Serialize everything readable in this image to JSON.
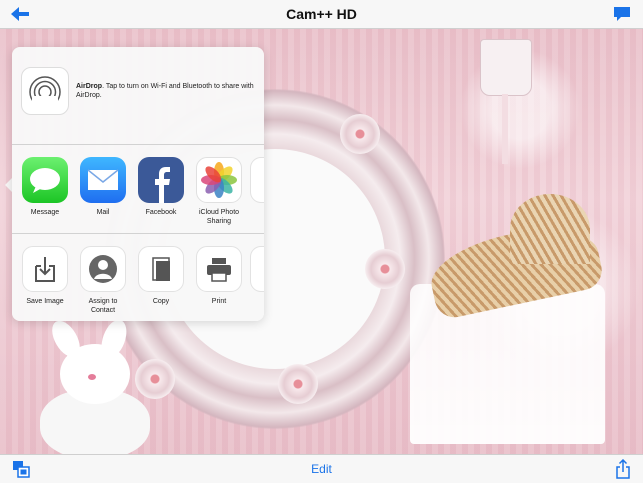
{
  "navbar": {
    "title": "Cam++ HD"
  },
  "share_sheet": {
    "airdrop": {
      "title": "AirDrop",
      "text": ". Tap to turn on Wi-Fi and Bluetooth to share with AirDrop."
    },
    "apps": [
      {
        "label": "Message",
        "icon": "message-icon"
      },
      {
        "label": "Mail",
        "icon": "mail-icon"
      },
      {
        "label": "Facebook",
        "icon": "facebook-icon"
      },
      {
        "label": "iCloud Photo Sharing",
        "icon": "photos-icon"
      }
    ],
    "actions": [
      {
        "label": "Save Image",
        "icon": "save-image-icon"
      },
      {
        "label": "Assign to Contact",
        "icon": "contact-icon"
      },
      {
        "label": "Copy",
        "icon": "copy-icon"
      },
      {
        "label": "Print",
        "icon": "print-icon"
      }
    ]
  },
  "toolbar": {
    "edit_label": "Edit"
  },
  "colors": {
    "accent": "#1a73e8",
    "nav_bg": "#f7f7f7"
  }
}
